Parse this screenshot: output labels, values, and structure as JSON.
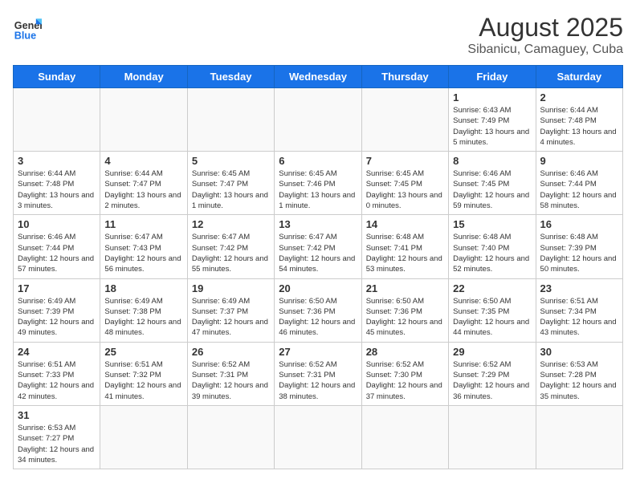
{
  "logo": {
    "text_general": "General",
    "text_blue": "Blue"
  },
  "header": {
    "month": "August 2025",
    "location": "Sibanicu, Camaguey, Cuba"
  },
  "weekdays": [
    "Sunday",
    "Monday",
    "Tuesday",
    "Wednesday",
    "Thursday",
    "Friday",
    "Saturday"
  ],
  "rows": [
    [
      null,
      null,
      null,
      null,
      null,
      {
        "day": "1",
        "info": "Sunrise: 6:43 AM\nSunset: 7:49 PM\nDaylight: 13 hours and 5 minutes."
      },
      {
        "day": "2",
        "info": "Sunrise: 6:44 AM\nSunset: 7:48 PM\nDaylight: 13 hours and 4 minutes."
      }
    ],
    [
      {
        "day": "3",
        "info": "Sunrise: 6:44 AM\nSunset: 7:48 PM\nDaylight: 13 hours and 3 minutes."
      },
      {
        "day": "4",
        "info": "Sunrise: 6:44 AM\nSunset: 7:47 PM\nDaylight: 13 hours and 2 minutes."
      },
      {
        "day": "5",
        "info": "Sunrise: 6:45 AM\nSunset: 7:47 PM\nDaylight: 13 hours and 1 minute."
      },
      {
        "day": "6",
        "info": "Sunrise: 6:45 AM\nSunset: 7:46 PM\nDaylight: 13 hours and 1 minute."
      },
      {
        "day": "7",
        "info": "Sunrise: 6:45 AM\nSunset: 7:45 PM\nDaylight: 13 hours and 0 minutes."
      },
      {
        "day": "8",
        "info": "Sunrise: 6:46 AM\nSunset: 7:45 PM\nDaylight: 12 hours and 59 minutes."
      },
      {
        "day": "9",
        "info": "Sunrise: 6:46 AM\nSunset: 7:44 PM\nDaylight: 12 hours and 58 minutes."
      }
    ],
    [
      {
        "day": "10",
        "info": "Sunrise: 6:46 AM\nSunset: 7:44 PM\nDaylight: 12 hours and 57 minutes."
      },
      {
        "day": "11",
        "info": "Sunrise: 6:47 AM\nSunset: 7:43 PM\nDaylight: 12 hours and 56 minutes."
      },
      {
        "day": "12",
        "info": "Sunrise: 6:47 AM\nSunset: 7:42 PM\nDaylight: 12 hours and 55 minutes."
      },
      {
        "day": "13",
        "info": "Sunrise: 6:47 AM\nSunset: 7:42 PM\nDaylight: 12 hours and 54 minutes."
      },
      {
        "day": "14",
        "info": "Sunrise: 6:48 AM\nSunset: 7:41 PM\nDaylight: 12 hours and 53 minutes."
      },
      {
        "day": "15",
        "info": "Sunrise: 6:48 AM\nSunset: 7:40 PM\nDaylight: 12 hours and 52 minutes."
      },
      {
        "day": "16",
        "info": "Sunrise: 6:48 AM\nSunset: 7:39 PM\nDaylight: 12 hours and 50 minutes."
      }
    ],
    [
      {
        "day": "17",
        "info": "Sunrise: 6:49 AM\nSunset: 7:39 PM\nDaylight: 12 hours and 49 minutes."
      },
      {
        "day": "18",
        "info": "Sunrise: 6:49 AM\nSunset: 7:38 PM\nDaylight: 12 hours and 48 minutes."
      },
      {
        "day": "19",
        "info": "Sunrise: 6:49 AM\nSunset: 7:37 PM\nDaylight: 12 hours and 47 minutes."
      },
      {
        "day": "20",
        "info": "Sunrise: 6:50 AM\nSunset: 7:36 PM\nDaylight: 12 hours and 46 minutes."
      },
      {
        "day": "21",
        "info": "Sunrise: 6:50 AM\nSunset: 7:36 PM\nDaylight: 12 hours and 45 minutes."
      },
      {
        "day": "22",
        "info": "Sunrise: 6:50 AM\nSunset: 7:35 PM\nDaylight: 12 hours and 44 minutes."
      },
      {
        "day": "23",
        "info": "Sunrise: 6:51 AM\nSunset: 7:34 PM\nDaylight: 12 hours and 43 minutes."
      }
    ],
    [
      {
        "day": "24",
        "info": "Sunrise: 6:51 AM\nSunset: 7:33 PM\nDaylight: 12 hours and 42 minutes."
      },
      {
        "day": "25",
        "info": "Sunrise: 6:51 AM\nSunset: 7:32 PM\nDaylight: 12 hours and 41 minutes."
      },
      {
        "day": "26",
        "info": "Sunrise: 6:52 AM\nSunset: 7:31 PM\nDaylight: 12 hours and 39 minutes."
      },
      {
        "day": "27",
        "info": "Sunrise: 6:52 AM\nSunset: 7:31 PM\nDaylight: 12 hours and 38 minutes."
      },
      {
        "day": "28",
        "info": "Sunrise: 6:52 AM\nSunset: 7:30 PM\nDaylight: 12 hours and 37 minutes."
      },
      {
        "day": "29",
        "info": "Sunrise: 6:52 AM\nSunset: 7:29 PM\nDaylight: 12 hours and 36 minutes."
      },
      {
        "day": "30",
        "info": "Sunrise: 6:53 AM\nSunset: 7:28 PM\nDaylight: 12 hours and 35 minutes."
      }
    ],
    [
      {
        "day": "31",
        "info": "Sunrise: 6:53 AM\nSunset: 7:27 PM\nDaylight: 12 hours and 34 minutes."
      },
      null,
      null,
      null,
      null,
      null,
      null
    ]
  ]
}
